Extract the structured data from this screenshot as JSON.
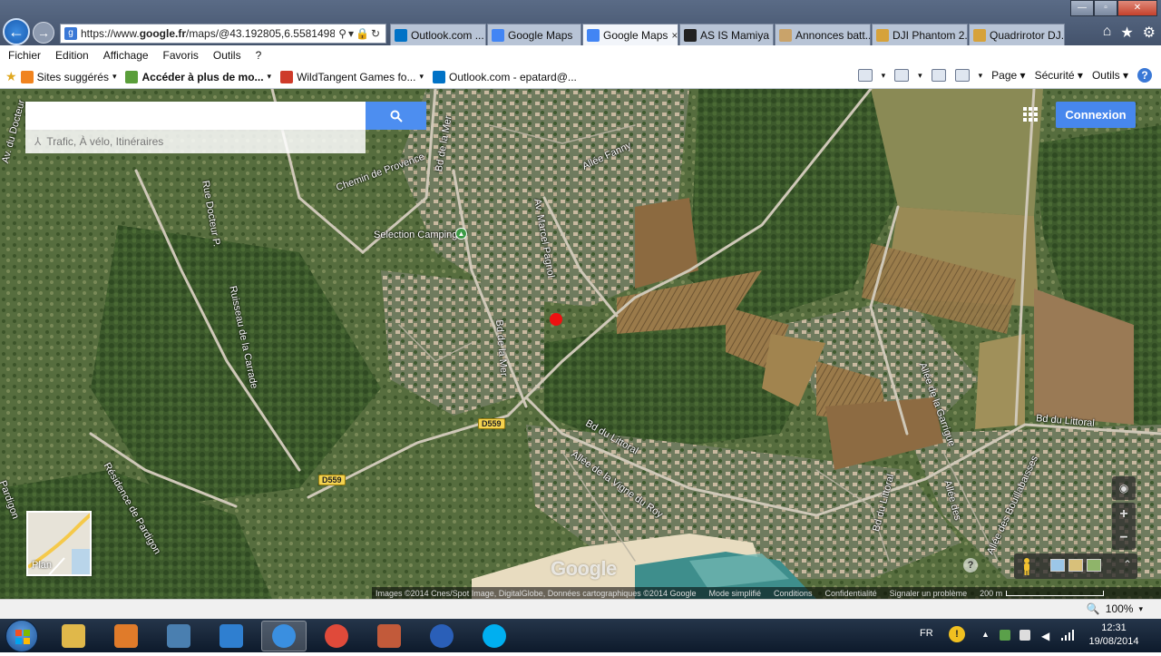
{
  "browser": {
    "address_url_prefix": "https://www.",
    "address_url_domain": "google.fr",
    "address_url_rest": "/maps/@43.192805,6.5581498,10",
    "tabs": [
      {
        "label": "Outlook.com ...",
        "color": "#0072c6",
        "active": false
      },
      {
        "label": "Google Maps",
        "color": "#4285f4",
        "active": false
      },
      {
        "label": "Google Maps",
        "color": "#4285f4",
        "active": true
      },
      {
        "label": "AS IS Mamiya ...",
        "color": "#222222",
        "active": false
      },
      {
        "label": "Annonces batt...",
        "color": "#c9a36a",
        "active": false
      },
      {
        "label": "DJI Phantom 2...",
        "color": "#d6a23a",
        "active": false
      },
      {
        "label": "Quadrirotor DJ...",
        "color": "#d6a23a",
        "active": false
      }
    ],
    "tab_close": "×",
    "menu": [
      "Fichier",
      "Edition",
      "Affichage",
      "Favoris",
      "Outils",
      "?"
    ],
    "favorites": [
      {
        "label": "Sites suggérés",
        "color": "#f0831e",
        "dropdown": true
      },
      {
        "label": "Accéder à plus de mo...",
        "color": "#5a9e3a",
        "dropdown": true
      },
      {
        "label": "WildTangent Games fo...",
        "color": "#ce3b2a",
        "dropdown": true
      },
      {
        "label": "Outlook.com - epatard@...",
        "color": "#0072c6",
        "dropdown": false
      }
    ],
    "commands": [
      "Page",
      "Sécurité",
      "Outils"
    ],
    "zoom_level": "100%"
  },
  "map": {
    "search_placeholder": "",
    "suggest_text": "Trafic, À vélo, Itinéraires",
    "connexion_label": "Connexion",
    "plan_label": "Plan",
    "google_logo": "Google",
    "labels": [
      {
        "text": "Av. du Docteur",
        "name": "label-av-du-docteur"
      },
      {
        "text": "Rue Docteur P.",
        "name": "label-rue-docteur"
      },
      {
        "text": "Chemin de Provence",
        "name": "label-chemin-de-provence"
      },
      {
        "text": "Bd de la Mer",
        "name": "label-bd-de-la-mer-north"
      },
      {
        "text": "Selection Camping",
        "name": "label-selection-camping"
      },
      {
        "text": "Allée Fanny",
        "name": "label-allee-fanny"
      },
      {
        "text": "Av. Marcel Pagnol",
        "name": "label-av-marcel-pagnol"
      },
      {
        "text": "Ruisseau de la Carrade",
        "name": "label-ruisseau-carrade"
      },
      {
        "text": "Bd de la Mer",
        "name": "label-bd-de-la-mer-south"
      },
      {
        "text": "Bd du Littoral",
        "name": "label-bd-du-littoral-east"
      },
      {
        "text": "Bd du Littoral",
        "name": "label-bd-du-littoral-center"
      },
      {
        "text": "Allée de la Vigne du Roy",
        "name": "label-allee-vigne-du-roy"
      },
      {
        "text": "Résidence de Pardigon",
        "name": "label-residence-pardigon"
      },
      {
        "text": "Pardigon",
        "name": "label-pardigon"
      },
      {
        "text": "Allée de la Garrigue",
        "name": "label-allee-garrigue"
      },
      {
        "text": "Bd du Littoral",
        "name": "label-bd-du-littoral-south"
      },
      {
        "text": "Allée des Bouillabaisses",
        "name": "label-allee-bouillabaisse"
      },
      {
        "text": "Allée des",
        "name": "label-allee-des"
      }
    ],
    "road_badges": [
      "D559",
      "D559"
    ],
    "footer": {
      "attribution": "Images ©2014 Cnes/Spot Image, DigitalGlobe, Données cartographiques ©2014 Google",
      "links": [
        "Mode simplifié",
        "Conditions",
        "Confidentialité",
        "Signaler un problème"
      ],
      "scale_label": "200 m"
    },
    "pin_color": "#e11111"
  },
  "taskbar": {
    "apps": [
      {
        "name": "explorer",
        "color": "#e0b84a",
        "active": false
      },
      {
        "name": "media-player",
        "color": "#e07b2a",
        "active": false
      },
      {
        "name": "camera-app",
        "color": "#4a7fb0",
        "active": false
      },
      {
        "name": "hp-app",
        "color": "#2f7fd0",
        "active": false
      },
      {
        "name": "internet-explorer",
        "color": "#3a8fe0",
        "active": true
      },
      {
        "name": "chrome",
        "color": "#e04a3a",
        "active": false
      },
      {
        "name": "printer-app",
        "color": "#c25a3a",
        "active": false
      },
      {
        "name": "globe-app",
        "color": "#2a5fb8",
        "active": false
      },
      {
        "name": "skype",
        "color": "#00aff0",
        "active": false
      }
    ],
    "language": "FR",
    "time": "12:31",
    "date": "19/08/2014"
  }
}
